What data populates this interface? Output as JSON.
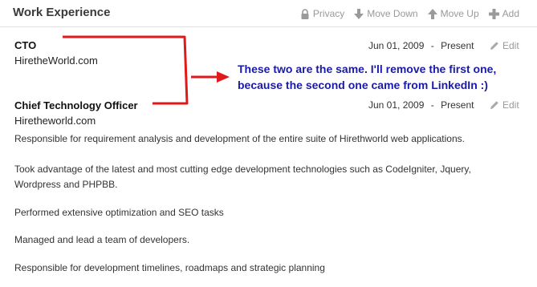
{
  "section": {
    "title": "Work Experience",
    "actions": [
      {
        "label": "Privacy",
        "icon": "lock-icon"
      },
      {
        "label": "Move Down",
        "icon": "arrow-down-icon"
      },
      {
        "label": "Move Up",
        "icon": "arrow-up-icon"
      },
      {
        "label": "Add",
        "icon": "plus-icon"
      }
    ]
  },
  "entries": [
    {
      "title": "CTO",
      "company": "HiretheWorld.com",
      "start": "Jun 01, 2009",
      "separator": "-",
      "end": "Present",
      "edit_label": "Edit"
    },
    {
      "title": "Chief Technology Officer",
      "company": "Hiretheworld.com",
      "start": "Jun 01, 2009",
      "separator": "-",
      "end": "Present",
      "edit_label": "Edit",
      "description": [
        "Responsible for requirement analysis and development of the entire suite of Hirethworld web applications.",
        "Took advantage of the latest and most cutting edge development technologies such as CodeIgniter, Jquery, Wordpress and PHPBB.",
        "Performed extensive optimization and SEO tasks",
        "Managed and lead a team of developers.",
        "Responsible for development timelines, roadmaps and strategic planning"
      ]
    }
  ],
  "annotation": {
    "line1": "These two are the same. I'll remove the first one,",
    "line2": "because the second one came from LinkedIn :)",
    "color": "#1a1aa8",
    "marker_color": "#e0191b"
  }
}
